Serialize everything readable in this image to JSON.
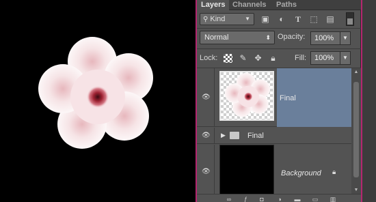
{
  "tabs": [
    "Layers",
    "Channels",
    "Paths"
  ],
  "filter": {
    "kind_label": "Kind"
  },
  "blend_mode": "Normal",
  "opacity": {
    "label": "Opacity:",
    "value": "100%"
  },
  "lock": {
    "label": "Lock:"
  },
  "fill": {
    "label": "Fill:",
    "value": "100%"
  },
  "layers": [
    {
      "name": "Final",
      "type": "pixel",
      "selected": true
    },
    {
      "name": "Final",
      "type": "group",
      "selected": false
    },
    {
      "name": "Background",
      "type": "background",
      "selected": false,
      "locked": true
    }
  ],
  "colors": {
    "accent_border": "#b5266f",
    "panel_bg": "#535353",
    "selection": "#6a7f9b",
    "flower_center": "#b02a3e"
  },
  "icons": {
    "filter_icons": [
      "image-icon",
      "adjustment-icon",
      "type-icon",
      "shape-icon",
      "smart-object-icon"
    ],
    "lock_icons": [
      "lock-transparent-icon",
      "lock-paint-icon",
      "lock-move-icon",
      "lock-all-icon"
    ],
    "footer_icons": [
      "link-icon",
      "fx-icon",
      "mask-icon",
      "adjustment-layer-icon",
      "folder-icon",
      "new-layer-icon",
      "trash-icon"
    ]
  }
}
